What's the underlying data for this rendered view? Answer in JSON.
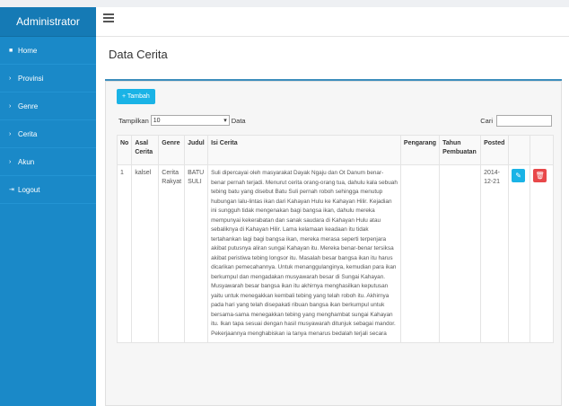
{
  "sidebar": {
    "brand": "Administrator",
    "items": [
      {
        "icon": "home-icon",
        "glyph": "■",
        "label": "Home"
      },
      {
        "icon": "chevron-right-icon",
        "glyph": "›",
        "label": "Provinsi"
      },
      {
        "icon": "chevron-right-icon",
        "glyph": "›",
        "label": "Genre"
      },
      {
        "icon": "chevron-right-icon",
        "glyph": "›",
        "label": "Cerita"
      },
      {
        "icon": "chevron-right-icon",
        "glyph": "›",
        "label": "Akun"
      },
      {
        "icon": "logout-icon",
        "glyph": "⇥",
        "label": "Logout"
      }
    ]
  },
  "main": {
    "title": "Data Cerita",
    "add_button": "+ Tambah",
    "show_label": "Tampilkan",
    "show_value": "10",
    "show_suffix": "Data",
    "search_label": "Cari"
  },
  "table": {
    "headers": [
      "No",
      "Asal Cerita",
      "Genre",
      "Judul",
      "Isi Cerita",
      "Pengarang",
      "Tahun Pembuatan",
      "Posted",
      "",
      ""
    ],
    "rows": [
      {
        "no": "1",
        "asal": "kalsel",
        "genre": "Cerita Rakyat",
        "judul": "BATU SULI",
        "isi": "Suli dipercayai oleh masyarakat Dayak Ngaju dan Ot Danum benar-benar pernah terjadi. Menurut cerita orang-orang tua, dahulu kala sebuah tebing batu yang disebut Batu Suli pernah roboh sehingga menutup hubungan lalu-lintas ikan dari Kahayan Hulu ke Kahayan Hilir. Kejadian ini sungguh tidak mengenakan bagi bangsa ikan, dahulu mereka mempunyai kekerabatan dan sanak saudara di Kahayan Hulu atau sebaliknya di Kahayan Hilir. Lama kelamaan keadaan itu tidak tertahankan lagi bagi bangsa ikan, mereka merasa seperti terpenjara akibat putusnya aliran sungai Kahayan itu. Mereka benar-benar tersiksa akibat peristiwa tebing longsor itu. Masalah besar bangsa ikan itu harus dicarikan pemecahannya. Untuk menanggulanginya, kemudian para ikan berkumpul dan mengadakan musyawarah besar di Sungai Kahayan. Musyawarah besar bangsa ikan itu akhirnya menghasilkan keputusan yaitu untuk menegakkan kembali tebing yang telah roboh itu. Akhirnya pada hari yang telah disepakati ribuan bangsa ikan berkumpul untuk bersama-sama menegakkan tebing yang menghambat sungai Kahayan itu. Ikan tapa sesuai dengan hasil musyawarah ditunjuk sebagai mandor. Pekerjaannya menghabiskan ia tanya menarus bedalah terjali secara",
        "pengarang": "",
        "tahun": "",
        "posted": "2014-12-21"
      }
    ]
  },
  "colors": {
    "sidebar": "#1a89c8",
    "accent": "#1ab3e6",
    "delete": "#e8484a"
  }
}
